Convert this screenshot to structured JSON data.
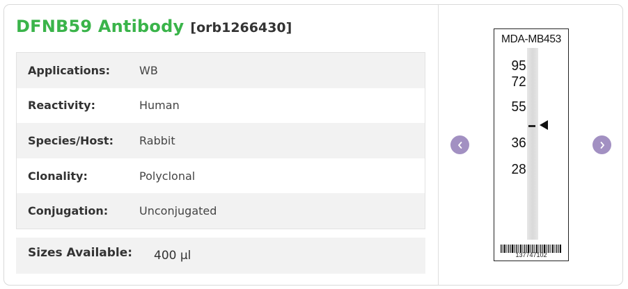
{
  "product": {
    "name": "DFNB59 Antibody",
    "code": "[orb1266430]"
  },
  "specs": [
    {
      "label": "Applications:",
      "value": "WB"
    },
    {
      "label": "Reactivity:",
      "value": "Human"
    },
    {
      "label": "Species/Host:",
      "value": "Rabbit"
    },
    {
      "label": "Clonality:",
      "value": "Polyclonal"
    },
    {
      "label": "Conjugation:",
      "value": "Unconjugated"
    }
  ],
  "sizes": {
    "label": "Sizes Available:",
    "value": "400 µl"
  },
  "image": {
    "sample_label": "MDA-MB453",
    "markers": [
      "95",
      "72",
      "55",
      "36",
      "28"
    ],
    "barcode_number": "137747102",
    "prev_icon": "chevron-left-icon",
    "next_icon": "chevron-right-icon"
  },
  "colors": {
    "title_green": "#3ab44a",
    "arrow_purple": "#a290c2"
  }
}
